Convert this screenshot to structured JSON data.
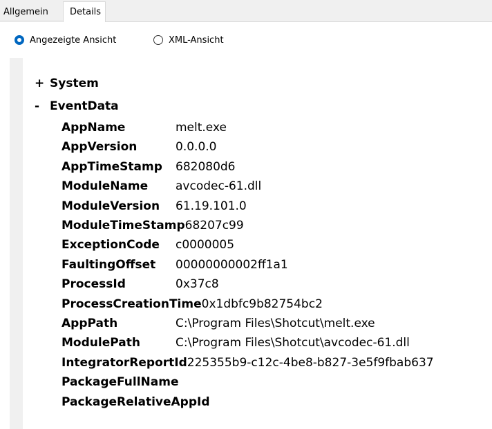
{
  "tabs": [
    {
      "label": "Allgemein"
    },
    {
      "label": "Details"
    }
  ],
  "view_options": {
    "displayed": "Angezeigte Ansicht",
    "xml": "XML-Ansicht",
    "selected": "displayed"
  },
  "tree": {
    "system": {
      "sign": "+",
      "label": "System"
    },
    "eventdata": {
      "sign": "-",
      "label": "EventData"
    }
  },
  "event_data": [
    {
      "key": "AppName",
      "value": "melt.exe"
    },
    {
      "key": "AppVersion",
      "value": "0.0.0.0"
    },
    {
      "key": "AppTimeStamp",
      "value": "682080d6"
    },
    {
      "key": "ModuleName",
      "value": "avcodec-61.dll"
    },
    {
      "key": "ModuleVersion",
      "value": "61.19.101.0"
    },
    {
      "key": "ModuleTimeStamp",
      "value": "68207c99"
    },
    {
      "key": "ExceptionCode",
      "value": "c0000005"
    },
    {
      "key": "FaultingOffset",
      "value": "00000000002ff1a1"
    },
    {
      "key": "ProcessId",
      "value": "0x37c8"
    },
    {
      "key": "ProcessCreationTime",
      "value": "0x1dbfc9b82754bc2"
    },
    {
      "key": "AppPath",
      "value": "C:\\Program Files\\Shotcut\\melt.exe"
    },
    {
      "key": "ModulePath",
      "value": "C:\\Program Files\\Shotcut\\avcodec-61.dll"
    },
    {
      "key": "IntegratorReportId",
      "value": "225355b9-c12c-4be8-b827-3e5f9fbab637"
    },
    {
      "key": "PackageFullName",
      "value": ""
    },
    {
      "key": "PackageRelativeAppId",
      "value": ""
    }
  ]
}
